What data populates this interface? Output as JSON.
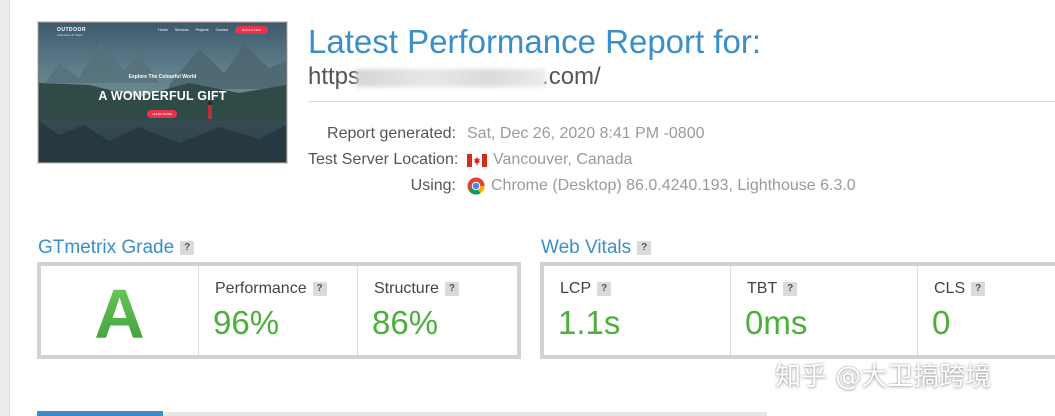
{
  "thumbnail": {
    "logo": "OUTDOOR",
    "logo_sub": "Adventure & Travel",
    "nav": [
      "Home",
      "Services",
      "Projects",
      "Contact"
    ],
    "nav_button": "BOOK A TRIP",
    "tagline": "Explore The Colourful World",
    "headline": "A WONDERFUL GIFT",
    "cta": "LEARN MORE"
  },
  "report": {
    "title": "Latest Performance Report for:",
    "url_prefix": "https",
    "url_suffix": ".com/"
  },
  "meta": {
    "generated_label": "Report generated:",
    "generated_value": "Sat, Dec 26, 2020 8:41 PM -0800",
    "location_label": "Test Server Location:",
    "location_value": "Vancouver, Canada",
    "location_icon": "canada-flag-icon",
    "using_label": "Using:",
    "using_value": "Chrome (Desktop) 86.0.4240.193, Lighthouse 6.3.0",
    "using_icon": "chrome-icon"
  },
  "grade_section": {
    "title": "GTmetrix Grade",
    "help": "?",
    "grade": "A",
    "performance_label": "Performance",
    "performance_value": "96%",
    "structure_label": "Structure",
    "structure_value": "86%"
  },
  "vitals_section": {
    "title": "Web Vitals",
    "help": "?",
    "lcp_label": "LCP",
    "lcp_value": "1.1s",
    "tbt_label": "TBT",
    "tbt_value": "0ms",
    "cls_label": "CLS",
    "cls_value": "0"
  },
  "watermark": "知乎 @大卫搞跨境",
  "colors": {
    "accent_blue": "#3a8ec9",
    "grade_green": "#4bb14a",
    "score_green": "#4caf3c",
    "panel_border": "#d2d2d2"
  }
}
